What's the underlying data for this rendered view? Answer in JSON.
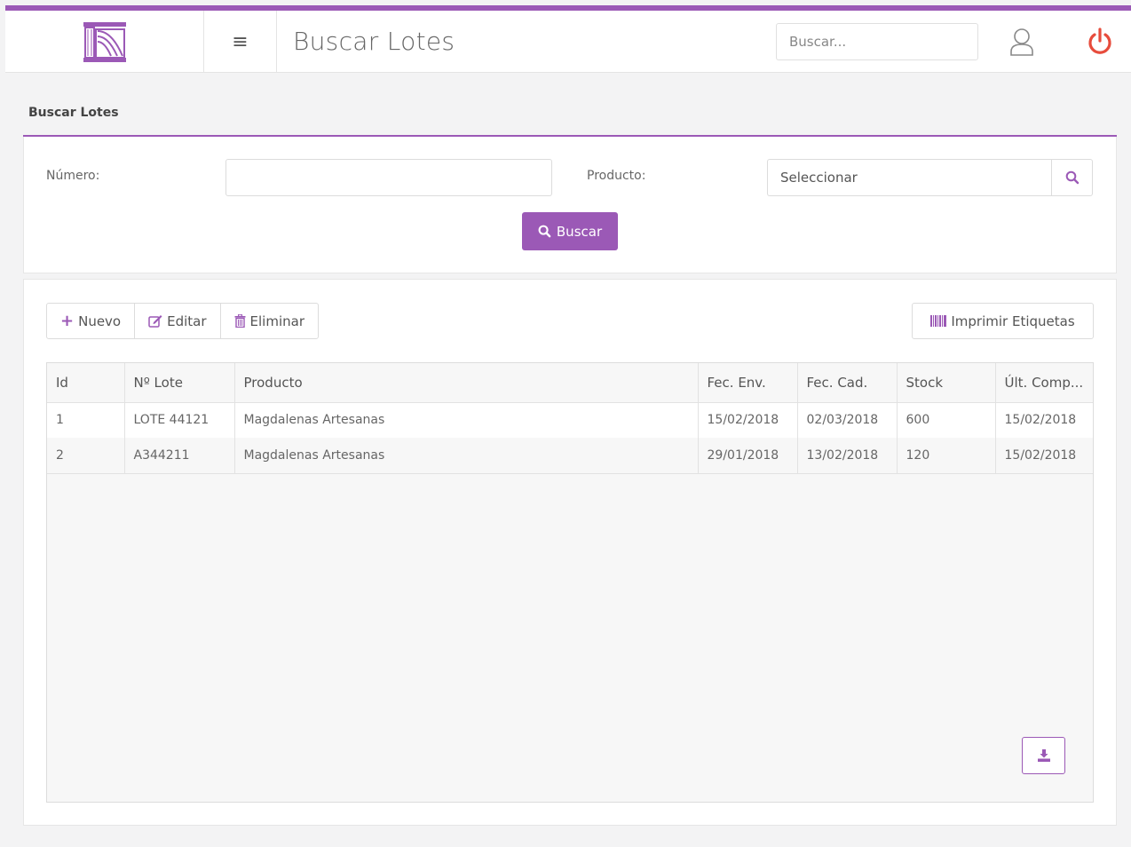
{
  "header": {
    "title": "Buscar Lotes",
    "search_placeholder": "Buscar..."
  },
  "filters": {
    "panel_title": "Buscar Lotes",
    "numero_label": "Número:",
    "numero_value": "",
    "producto_label": "Producto:",
    "producto_value": "Seleccionar",
    "buscar_label": "Buscar"
  },
  "toolbar": {
    "nuevo_label": "Nuevo",
    "editar_label": "Editar",
    "eliminar_label": "Eliminar",
    "imprimir_label": "Imprimir Etiquetas"
  },
  "table": {
    "columns": [
      "Id",
      "Nº Lote",
      "Producto",
      "Fec. Env.",
      "Fec. Cad.",
      "Stock",
      "Últ. Comp..."
    ],
    "rows": [
      [
        "1",
        "LOTE 44121",
        "Magdalenas Artesanas",
        "15/02/2018",
        "02/03/2018",
        "600",
        "15/02/2018"
      ],
      [
        "2",
        "A344211",
        "Magdalenas Artesanas",
        "29/01/2018",
        "13/02/2018",
        "120",
        "15/02/2018"
      ]
    ]
  },
  "colors": {
    "accent": "#9b59b6",
    "power": "#e74c3c"
  },
  "icons": {
    "logo": "columns-logo-icon",
    "menu": "hamburger-icon",
    "user": "user-icon",
    "power": "power-icon",
    "search": "search-icon",
    "plus": "plus-icon",
    "edit": "edit-icon",
    "trash": "trash-icon",
    "barcode": "barcode-icon",
    "download": "download-icon"
  }
}
